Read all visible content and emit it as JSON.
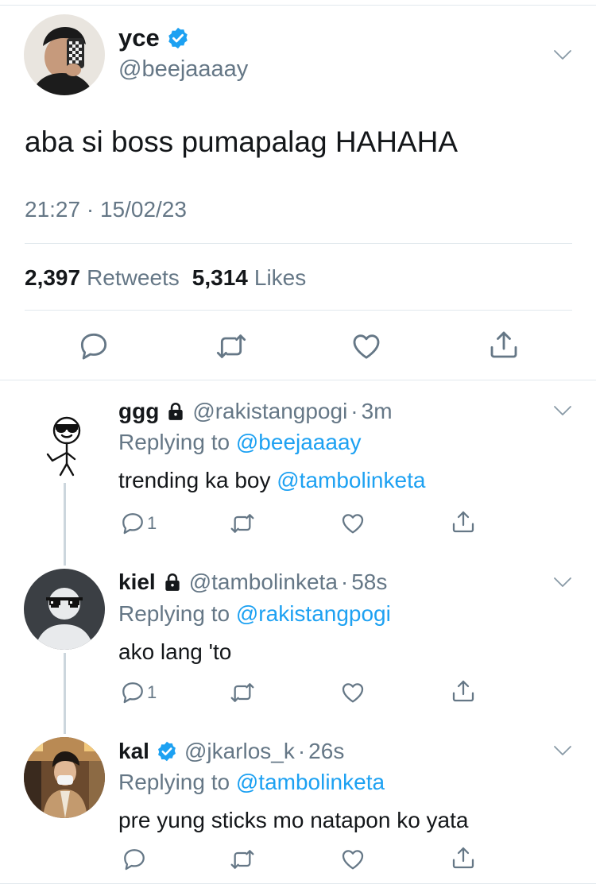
{
  "main_tweet": {
    "name": "yce",
    "handle": "@beejaaaay",
    "text": "aba si boss pumapalag HAHAHA",
    "timestamp": "21:27 · 15/02/23",
    "retweets_count": "2,397",
    "retweets_label": "Retweets",
    "likes_count": "5,314",
    "likes_label": "Likes"
  },
  "replies": [
    {
      "name": "ggg",
      "handle": "@rakistangpogi",
      "separator": "·",
      "time": "3m",
      "replying_prefix": "Replying to",
      "replying_to": "@beejaaaay",
      "text": "trending ka boy",
      "mention": "@tambolinketa",
      "reply_count": "1"
    },
    {
      "name": "kiel",
      "handle": "@tambolinketa",
      "separator": "·",
      "time": "58s",
      "replying_prefix": "Replying to",
      "replying_to": "@rakistangpogi",
      "text": "ako lang 'to",
      "reply_count": "1"
    },
    {
      "name": "kal",
      "handle": "@jkarlos_k",
      "separator": "·",
      "time": "26s",
      "replying_prefix": "Replying to",
      "replying_to": "@tambolinketa",
      "text": "pre yung sticks mo natapon ko yata"
    }
  ],
  "colors": {
    "accent": "#1da1f2",
    "secondary_text": "#657786",
    "primary_text": "#14171a",
    "divider": "#e1e8ed",
    "thread_line": "#ccd6dd"
  },
  "icons": [
    "verified-badge-icon",
    "chevron-down-icon",
    "reply-icon",
    "retweet-icon",
    "like-icon",
    "share-icon",
    "lock-icon"
  ]
}
